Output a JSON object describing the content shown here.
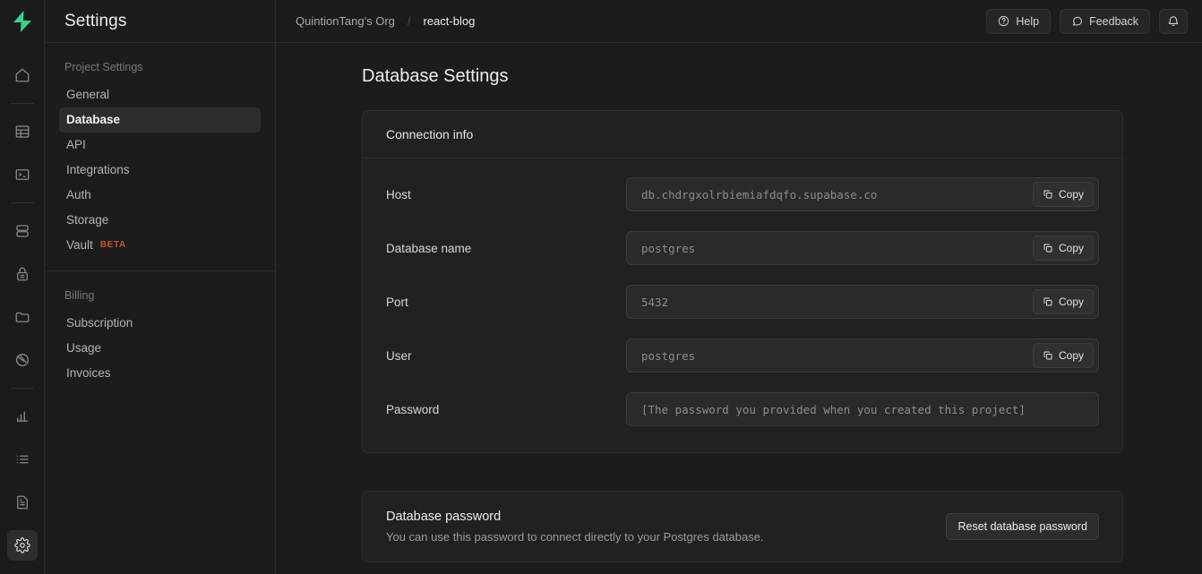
{
  "brand": {
    "logo_icon": "supabase-bolt-logo",
    "accent_color": "#3ECF8E"
  },
  "rail": {
    "items": [
      {
        "icon": "home-icon",
        "name": "home"
      },
      {
        "icon": "table-icon",
        "name": "table-editor"
      },
      {
        "icon": "sql-terminal-icon",
        "name": "sql-editor"
      },
      {
        "icon": "database-icon",
        "name": "database"
      },
      {
        "icon": "lock-icon",
        "name": "authentication"
      },
      {
        "icon": "folder-icon",
        "name": "storage"
      },
      {
        "icon": "edge-functions-icon",
        "name": "edge-functions"
      },
      {
        "icon": "bar-chart-icon",
        "name": "reports"
      },
      {
        "icon": "list-icon",
        "name": "logs"
      },
      {
        "icon": "document-icon",
        "name": "api-docs"
      },
      {
        "icon": "gear-icon",
        "name": "settings"
      }
    ]
  },
  "sidebar": {
    "title": "Settings",
    "groups": [
      {
        "heading": "Project Settings",
        "items": [
          {
            "label": "General",
            "active": false
          },
          {
            "label": "Database",
            "active": true
          },
          {
            "label": "API",
            "active": false
          },
          {
            "label": "Integrations",
            "active": false
          },
          {
            "label": "Auth",
            "active": false
          },
          {
            "label": "Storage",
            "active": false
          },
          {
            "label": "Vault",
            "active": false,
            "badge": "BETA"
          }
        ]
      },
      {
        "heading": "Billing",
        "items": [
          {
            "label": "Subscription",
            "active": false
          },
          {
            "label": "Usage",
            "active": false
          },
          {
            "label": "Invoices",
            "active": false
          }
        ]
      }
    ],
    "badge_color": "#c4542a"
  },
  "topbar": {
    "breadcrumb": {
      "org": "QuintionTang's Org",
      "separator": "/",
      "project": "react-blog"
    },
    "help_label": "Help",
    "help_icon": "question-circle-icon",
    "feedback_label": "Feedback",
    "feedback_icon": "message-icon",
    "notifications_icon": "bell-icon"
  },
  "main": {
    "page_title": "Database Settings",
    "connection_card": {
      "title": "Connection info",
      "copy_label": "Copy",
      "copy_icon": "copy-icon",
      "rows": [
        {
          "label": "Host",
          "value": "db.chdrgxolrbiemiafdqfo.supabase.co",
          "copyable": true
        },
        {
          "label": "Database name",
          "value": "postgres",
          "copyable": true
        },
        {
          "label": "Port",
          "value": "5432",
          "copyable": true
        },
        {
          "label": "User",
          "value": "postgres",
          "copyable": true
        },
        {
          "label": "Password",
          "value": "[The password you provided when you created this project]",
          "copyable": false
        }
      ]
    },
    "password_card": {
      "title": "Database password",
      "description": "You can use this password to connect directly to your Postgres database.",
      "reset_label": "Reset database password"
    }
  }
}
